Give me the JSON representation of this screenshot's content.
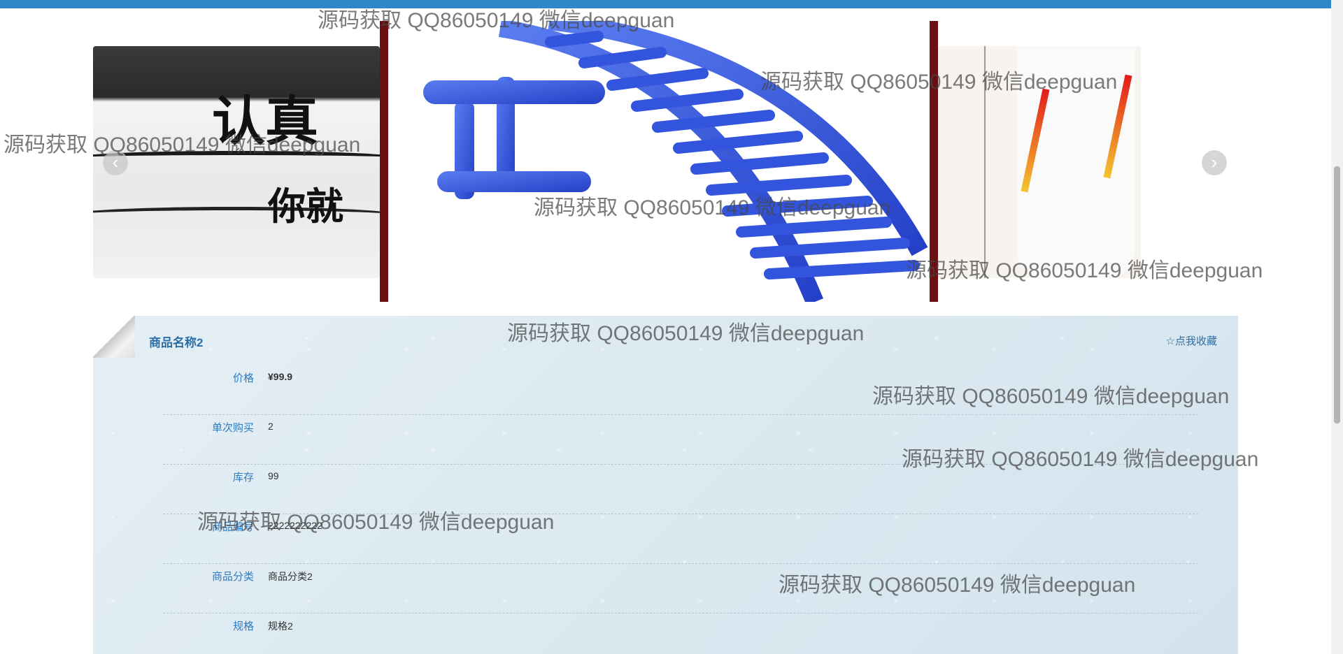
{
  "carousel": {
    "prev_symbol": "‹",
    "next_symbol": "›",
    "slide_left_text_1": "认真",
    "slide_left_text_2": "你就"
  },
  "product": {
    "name": "商品名称2",
    "favorite_label": "☆点我收藏",
    "fields": [
      {
        "label": "价格",
        "value": "¥99.9"
      },
      {
        "label": "单次购买",
        "value": "2"
      },
      {
        "label": "库存",
        "value": "99"
      },
      {
        "label": "商品编号",
        "value": "2222222222"
      },
      {
        "label": "商品分类",
        "value": "商品分类2"
      },
      {
        "label": "规格",
        "value": "规格2"
      }
    ]
  },
  "watermark": "源码获取 QQ86050149 微信deepguan",
  "colors": {
    "topbar": "#2f86c8",
    "label": "#2e7cc2",
    "title": "#2e6ea6",
    "panel_bg": "#dbe9f1"
  }
}
